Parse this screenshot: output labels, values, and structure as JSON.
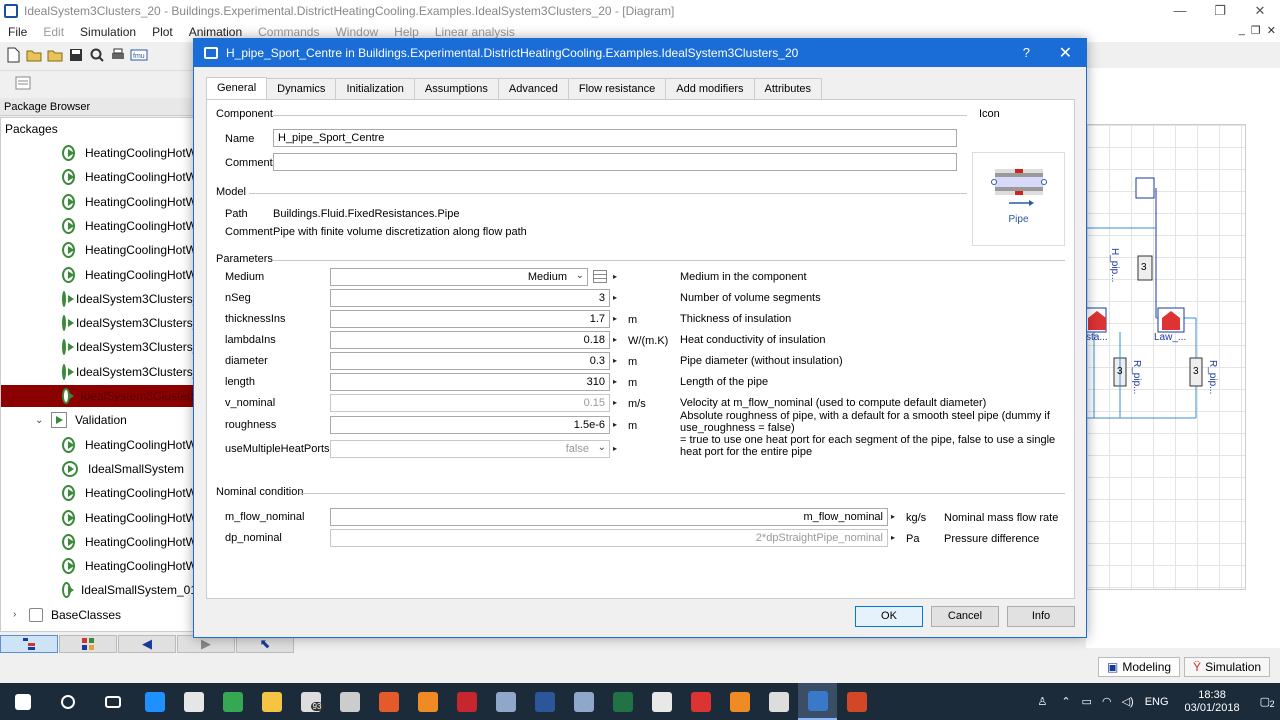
{
  "main_window": {
    "title": "IdealSystem3Clusters_20 - Buildings.Experimental.DistrictHeatingCooling.Examples.IdealSystem3Clusters_20 - [Diagram]",
    "controls": [
      "—",
      "❐",
      "✕"
    ],
    "mdi_controls": [
      "_",
      "❐",
      "✕"
    ],
    "menu": [
      {
        "label": "File",
        "dim": false
      },
      {
        "label": "Edit",
        "dim": true
      },
      {
        "label": "Simulation",
        "dim": false
      },
      {
        "label": "Plot",
        "dim": false
      },
      {
        "label": "Animation",
        "dim": false
      },
      {
        "label": "Commands",
        "dim": true
      },
      {
        "label": "Window",
        "dim": true
      },
      {
        "label": "Help",
        "dim": true
      },
      {
        "label": "Linear analysis",
        "dim": true
      }
    ]
  },
  "package_browser": {
    "header": "Package Browser",
    "title": "Packages",
    "items": [
      {
        "label": "HeatingCoolingHotW",
        "kind": "model",
        "selected": false
      },
      {
        "label": "HeatingCoolingHotW",
        "kind": "model",
        "selected": false
      },
      {
        "label": "HeatingCoolingHotW",
        "kind": "model",
        "selected": false
      },
      {
        "label": "HeatingCoolingHotW",
        "kind": "model",
        "selected": false
      },
      {
        "label": "HeatingCoolingHotW",
        "kind": "model",
        "selected": false
      },
      {
        "label": "HeatingCoolingHotW",
        "kind": "model",
        "selected": false
      },
      {
        "label": "IdealSystem3Clusters_",
        "kind": "model",
        "selected": false
      },
      {
        "label": "IdealSystem3Clusters_",
        "kind": "model",
        "selected": false
      },
      {
        "label": "IdealSystem3Clusters_",
        "kind": "model",
        "selected": false
      },
      {
        "label": "IdealSystem3Clusters_",
        "kind": "model",
        "selected": false
      },
      {
        "label": "IdealSystem3Clusters",
        "kind": "model",
        "selected": true
      },
      {
        "label": "Validation",
        "kind": "package",
        "selected": false
      },
      {
        "label": "HeatingCoolingHotW",
        "kind": "model",
        "selected": false
      },
      {
        "label": "IdealSmallSystem",
        "kind": "model",
        "selected": false
      },
      {
        "label": "HeatingCoolingHotW",
        "kind": "model",
        "selected": false
      },
      {
        "label": "HeatingCoolingHotW",
        "kind": "model",
        "selected": false
      },
      {
        "label": "HeatingCoolingHotW",
        "kind": "model",
        "selected": false
      },
      {
        "label": "HeatingCoolingHotW",
        "kind": "model",
        "selected": false
      },
      {
        "label": "IdealSmallSystem_01",
        "kind": "model",
        "selected": false
      },
      {
        "label": "BaseClasses",
        "kind": "folder",
        "selected": false
      }
    ]
  },
  "diagram": {
    "labels": [
      "H_pip...",
      "Law_...",
      "sta...",
      "R_pip...",
      "R_pip...",
      "3",
      "3",
      "3"
    ]
  },
  "mode_tabs": {
    "modeling": "Modeling",
    "simulation": "Simulation"
  },
  "dialog": {
    "title": "H_pipe_Sport_Centre in Buildings.Experimental.DistrictHeatingCooling.Examples.IdealSystem3Clusters_20",
    "help": "?",
    "close": "✕",
    "tabs": [
      "General",
      "Dynamics",
      "Initialization",
      "Assumptions",
      "Advanced",
      "Flow resistance",
      "Add modifiers",
      "Attributes"
    ],
    "active_tab": "General",
    "component": {
      "section": "Component",
      "name_label": "Name",
      "name_value": "H_pipe_Sport_Centre",
      "comment_label": "Comment",
      "comment_value": ""
    },
    "icon": {
      "section": "Icon",
      "caption": "Pipe"
    },
    "model": {
      "section": "Model",
      "path_label": "Path",
      "path_value": "Buildings.Fluid.FixedResistances.Pipe",
      "comment_label": "Comment",
      "comment_value": "Pipe with finite volume discretization along flow path"
    },
    "parameters": {
      "section": "Parameters",
      "rows": [
        {
          "name": "Medium",
          "value": "Medium",
          "unit": "",
          "desc": "Medium in the component",
          "type": "dropdown",
          "dim": false
        },
        {
          "name": "nSeg",
          "value": "3",
          "unit": "",
          "desc": "Number of volume segments",
          "type": "field",
          "dim": false
        },
        {
          "name": "thicknessIns",
          "value": "1.7",
          "unit": "m",
          "desc": "Thickness of insulation",
          "type": "field",
          "dim": false
        },
        {
          "name": "lambdaIns",
          "value": "0.18",
          "unit": "W/(m.K)",
          "desc": "Heat conductivity of insulation",
          "type": "field",
          "dim": false
        },
        {
          "name": "diameter",
          "value": "0.3",
          "unit": "m",
          "desc": "Pipe diameter (without insulation)",
          "type": "field",
          "dim": false
        },
        {
          "name": "length",
          "value": "310",
          "unit": "m",
          "desc": "Length of the pipe",
          "type": "field",
          "dim": false
        },
        {
          "name": "v_nominal",
          "value": "0.15",
          "unit": "m/s",
          "desc": "Velocity at m_flow_nominal (used to compute default diameter)",
          "type": "field",
          "dim": true
        },
        {
          "name": "roughness",
          "value": "1.5e-6",
          "unit": "m",
          "desc": "Absolute roughness of pipe, with a default for a smooth steel pipe (dummy if",
          "desc2": "use_roughness = false)",
          "type": "field",
          "dim": false
        },
        {
          "name": "useMultipleHeatPorts",
          "value": "false",
          "unit": "",
          "desc": "= true to use one heat port for each segment of the pipe, false to use a single",
          "desc2": "heat port for the entire pipe",
          "type": "dropdown",
          "dim": true
        }
      ]
    },
    "nominal": {
      "section": "Nominal condition",
      "rows": [
        {
          "name": "m_flow_nominal",
          "value": "m_flow_nominal",
          "unit": "kg/s",
          "desc": "Nominal mass flow rate",
          "dim": false
        },
        {
          "name": "dp_nominal",
          "value": "2*dpStraightPipe_nominal",
          "unit": "Pa",
          "desc": "Pressure difference",
          "dim": true
        }
      ]
    },
    "buttons": {
      "ok": "OK",
      "cancel": "Cancel",
      "info": "Info"
    }
  },
  "taskbar": {
    "badge": "93",
    "language": "ENG",
    "time": "18:38",
    "date": "03/01/2018",
    "notifications": "2",
    "apps": [
      {
        "name": "start-icon",
        "color": "#ffffff"
      },
      {
        "name": "search-icon",
        "color": "#ffffff"
      },
      {
        "name": "task-view-icon",
        "color": "#ffffff"
      },
      {
        "name": "edge-icon",
        "color": "#1e90ff"
      },
      {
        "name": "store-icon",
        "color": "#e6e6e6"
      },
      {
        "name": "chrome-icon",
        "color": "#34a853"
      },
      {
        "name": "explorer-icon",
        "color": "#f4c542"
      },
      {
        "name": "mail-icon",
        "color": "#dddddd"
      },
      {
        "name": "video-editor-icon",
        "color": "#cccccc"
      },
      {
        "name": "app-orange-icon",
        "color": "#e55a2b"
      },
      {
        "name": "app-photo-icon",
        "color": "#f08a24"
      },
      {
        "name": "app-red-icon",
        "color": "#c7262f"
      },
      {
        "name": "app-r-icon",
        "color": "#8fa7c9"
      },
      {
        "name": "word-icon",
        "color": "#2b579a"
      },
      {
        "name": "app-r2-icon",
        "color": "#8fa7c9"
      },
      {
        "name": "excel-icon",
        "color": "#217346"
      },
      {
        "name": "itunes-icon",
        "color": "#e8e8e8"
      },
      {
        "name": "ide-icon",
        "color": "#d33"
      },
      {
        "name": "app-orange2-icon",
        "color": "#f08a24"
      },
      {
        "name": "app-paint-icon",
        "color": "#dddddd"
      },
      {
        "name": "dymola-icon",
        "color": "#3a78c9"
      },
      {
        "name": "powerpoint-icon",
        "color": "#d24726"
      }
    ]
  }
}
